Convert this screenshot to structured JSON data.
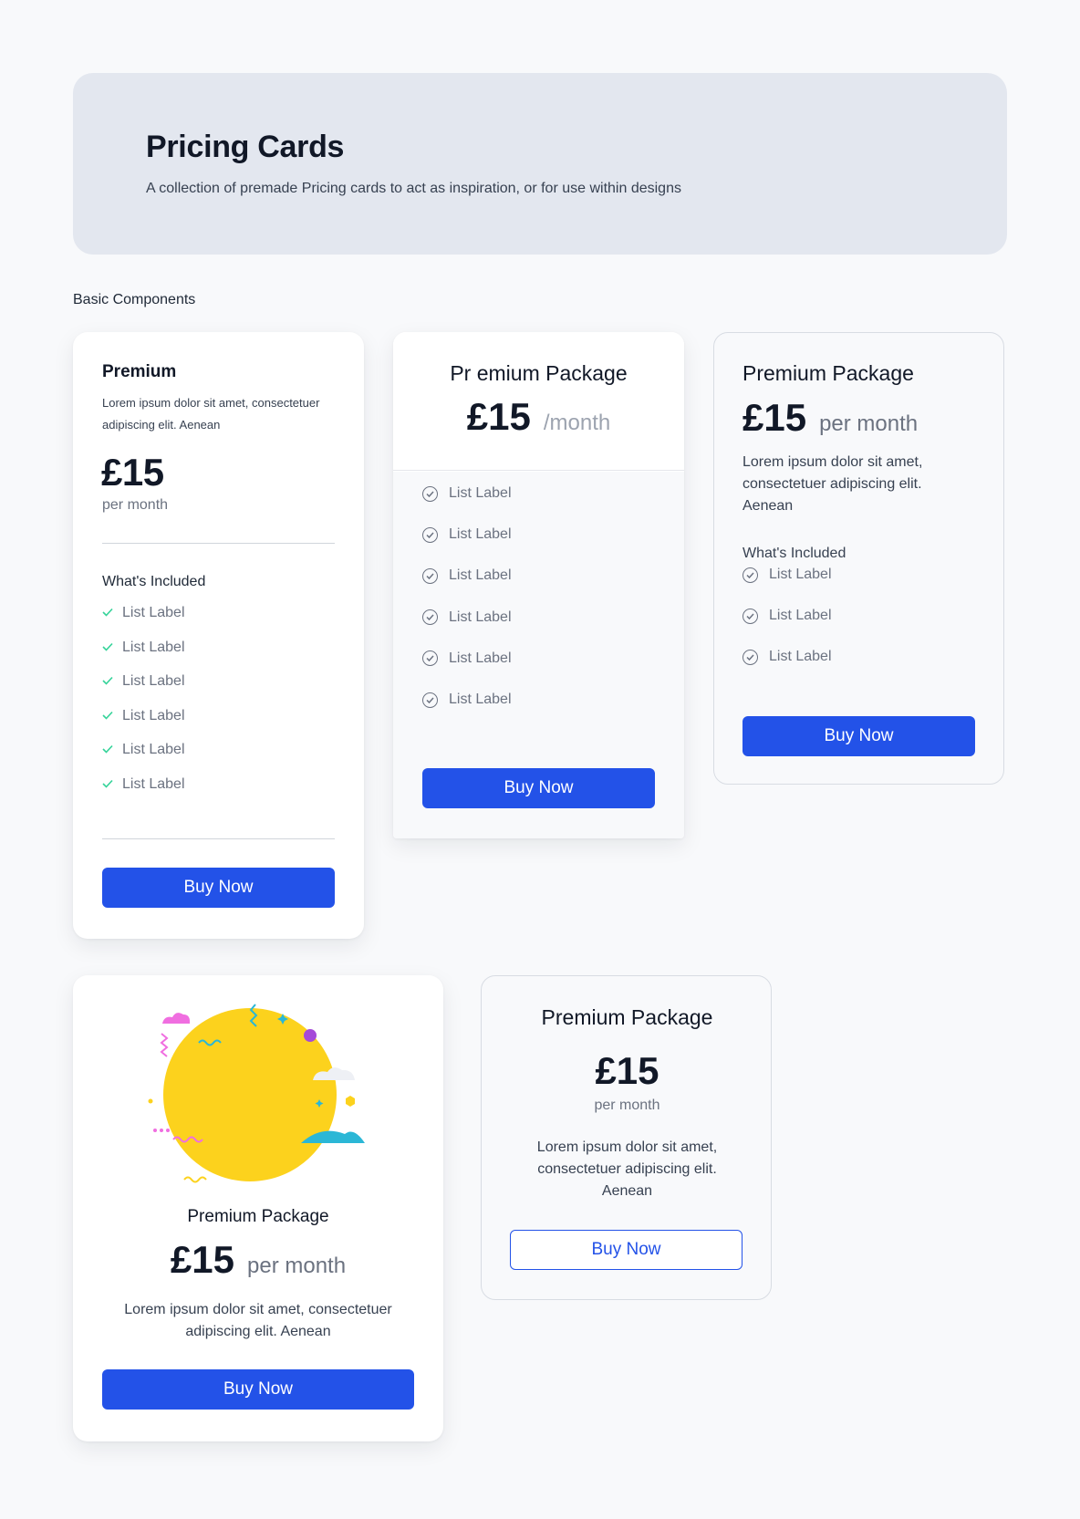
{
  "hero": {
    "title": "Pricing Cards",
    "subtitle": "A collection of premade Pricing cards to act as inspiration, or for use within designs"
  },
  "section_label": "Basic Components",
  "colors": {
    "accent": "#2352e8",
    "check_green": "#34d399",
    "hero_bg": "#e3e7ef",
    "sun": "#fcd21d"
  },
  "card1": {
    "title": "Premium",
    "description": "Lorem ipsum dolor sit amet, consectetuer adipiscing elit. Aenean",
    "price": "£15",
    "period": "per month",
    "included_heading": "What's Included",
    "items": [
      "List Label",
      "List Label",
      "List Label",
      "List Label",
      "List Label",
      "List Label"
    ],
    "button": "Buy Now"
  },
  "card2": {
    "title": "Pr emium Package",
    "price": "£15",
    "period": "/month",
    "items": [
      "List Label",
      "List Label",
      "List Label",
      "List Label",
      "List Label",
      "List Label"
    ],
    "button": "Buy Now"
  },
  "card3": {
    "title": "Premium Package",
    "price": "£15",
    "period": "per month",
    "description": "Lorem ipsum dolor sit amet, consectetuer adipiscing elit. Aenean",
    "included_heading": "What's Included",
    "items": [
      "List Label",
      "List Label",
      "List Label"
    ],
    "button": "Buy Now"
  },
  "card4": {
    "title": "Premium Package",
    "price": "£15",
    "period": "per month",
    "description": "Lorem ipsum dolor sit amet, consectetuer adipiscing elit. Aenean",
    "button": "Buy Now",
    "illustration": "sun-illustration"
  },
  "card5": {
    "title": "Premium Package",
    "price": "£15",
    "period": "per month",
    "description": "Lorem ipsum dolor sit amet, consectetuer adipiscing elit. Aenean",
    "button": "Buy Now"
  }
}
